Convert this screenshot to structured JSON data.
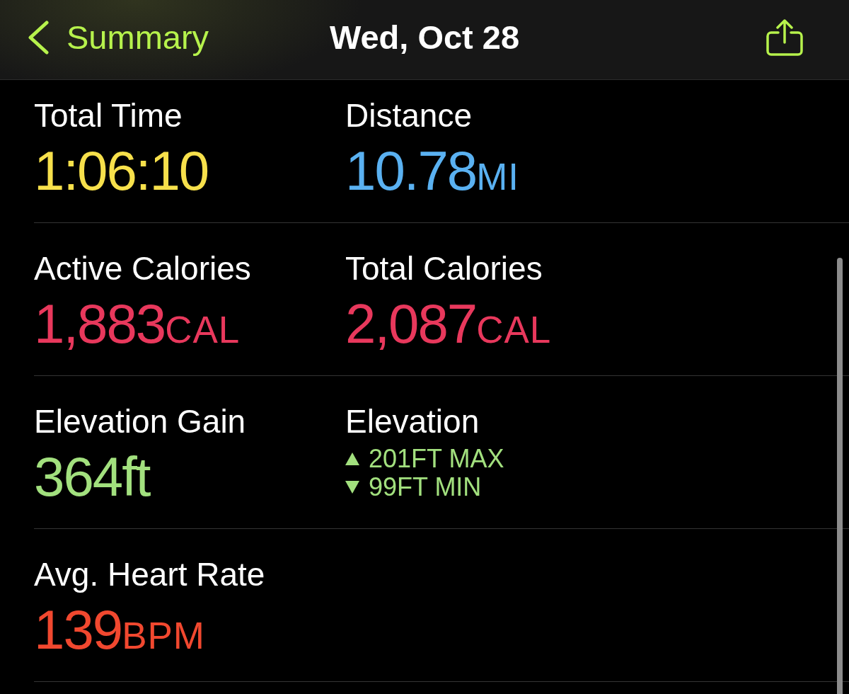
{
  "nav": {
    "back_label": "Summary",
    "title": "Wed, Oct 28"
  },
  "rows": [
    {
      "cells": [
        {
          "kind": "value",
          "label": "Total Time",
          "value": "1:06:10",
          "color": "#f7e04b"
        },
        {
          "kind": "value",
          "label": "Distance",
          "value": "10.78",
          "unit": "MI",
          "color": "#5ab1f1"
        }
      ]
    },
    {
      "cells": [
        {
          "kind": "value",
          "label": "Active Calories",
          "value": "1,883",
          "unit": "CAL",
          "color": "#e8385c"
        },
        {
          "kind": "value",
          "label": "Total Calories",
          "value": "2,087",
          "unit": "CAL",
          "color": "#e8385c"
        }
      ]
    },
    {
      "cells": [
        {
          "kind": "value",
          "label": "Elevation Gain",
          "value": "364ft",
          "color": "#a2e07e"
        },
        {
          "kind": "range",
          "label": "Elevation",
          "color": "#a2e07e",
          "lines": [
            {
              "kind": "max",
              "text": "201FT MAX"
            },
            {
              "kind": "min",
              "text": "99FT MIN"
            }
          ]
        }
      ]
    },
    {
      "cells": [
        {
          "kind": "value",
          "label": "Avg. Heart Rate",
          "value": "139",
          "unit": "BPM",
          "color": "#f1482f"
        }
      ]
    }
  ]
}
